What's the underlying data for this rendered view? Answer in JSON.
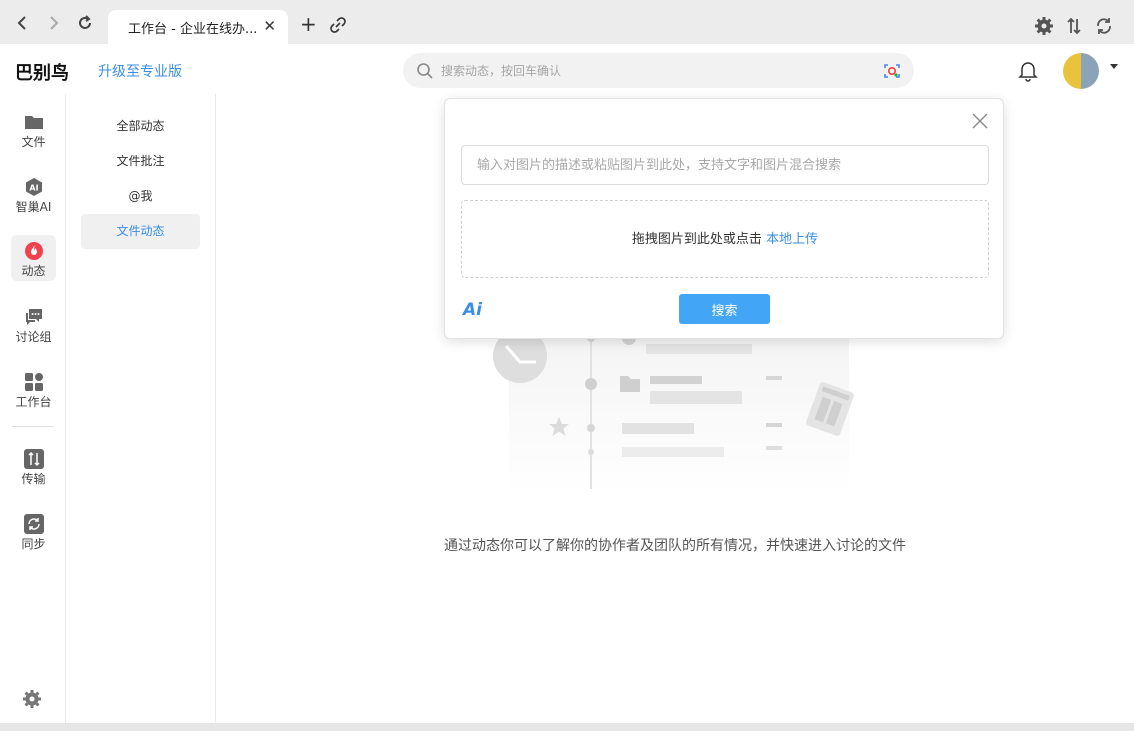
{
  "browser": {
    "tab_title": "工作台 - 企业在线办...",
    "back_icon": "back-arrow-icon",
    "forward_icon": "forward-arrow-icon",
    "reload_icon": "reload-icon"
  },
  "header": {
    "brand": "巴别鸟",
    "upgrade_label": "升级至专业版",
    "search_placeholder": "搜索动态，按回车确认"
  },
  "sidebar": {
    "items": [
      {
        "label": "文件",
        "icon": "folder-icon"
      },
      {
        "label": "智巢AI",
        "icon": "ai-icon"
      },
      {
        "label": "动态",
        "icon": "flame-icon"
      },
      {
        "label": "讨论组",
        "icon": "chat-icon"
      },
      {
        "label": "工作台",
        "icon": "apps-icon"
      },
      {
        "label": "传输",
        "icon": "transfer-icon"
      },
      {
        "label": "同步",
        "icon": "sync-icon"
      }
    ],
    "active_index": 2
  },
  "subnav": {
    "items": [
      {
        "label": "全部动态"
      },
      {
        "label": "文件批注"
      },
      {
        "label": "@我"
      },
      {
        "label": "文件动态"
      }
    ],
    "active_index": 3
  },
  "main": {
    "empty_text": "通过动态你可以了解你的协作者及团队的所有情况，并快速进入讨论的文件"
  },
  "modal": {
    "input_placeholder": "输入对图片的描述或粘贴图片到此处，支持文字和图片混合搜索",
    "drop_text": "拖拽图片到此处或点击",
    "upload_link": "本地上传",
    "logo_text": "Ai",
    "search_button": "搜索"
  },
  "colors": {
    "accent": "#3a8ee6",
    "button": "#42a5f5",
    "active_flame": "#f0434f"
  }
}
